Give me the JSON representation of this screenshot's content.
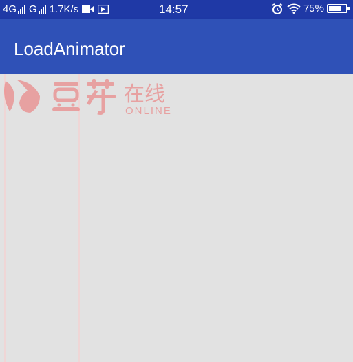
{
  "status_bar": {
    "network1": "4G",
    "network2": "G",
    "speed": "1.7K/s",
    "time": "14:57",
    "battery_text": "75%",
    "battery_level": 0.75,
    "icons": [
      "signal-icon",
      "video-icon",
      "media-icon",
      "alarm-icon",
      "wifi-icon",
      "battery-icon"
    ]
  },
  "app_bar": {
    "title": "LoadAnimator",
    "color": "#2f51b7"
  },
  "watermark": {
    "name": "豆芽",
    "tagline": "在线",
    "subtitle": "ONLINE",
    "color": "#ec6d6d"
  },
  "colors": {
    "status_bar": "#1f39a6",
    "background": "#e2e2e2"
  }
}
